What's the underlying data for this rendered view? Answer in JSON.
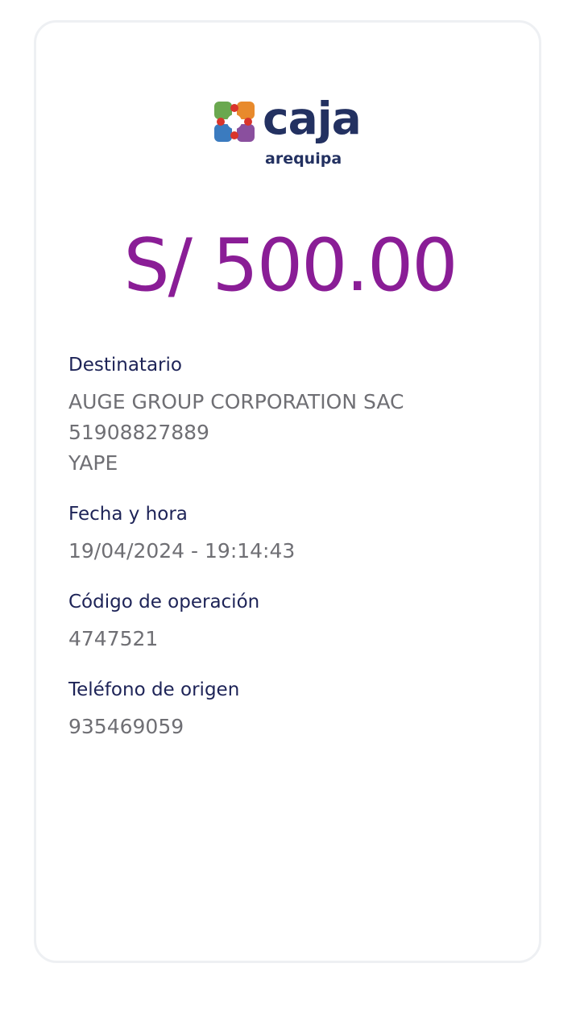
{
  "brand": {
    "name": "caja",
    "subname": "arequipa",
    "colors": {
      "navy": "#233161",
      "purple": "#8a1d96",
      "green": "#6aa84f",
      "red": "#d9342b",
      "blue": "#3b7bbf",
      "orange": "#e88a2c"
    }
  },
  "receipt": {
    "amount": "S/ 500.00",
    "recipient": {
      "label": "Destinatario",
      "name": "AUGE GROUP CORPORATION SAC",
      "phone": "51908827889",
      "wallet": "YAPE"
    },
    "datetime": {
      "label": "Fecha y hora",
      "value": "19/04/2024 - 19:14:43"
    },
    "operation_code": {
      "label": "Código de operación",
      "value": "4747521"
    },
    "origin_phone": {
      "label": "Teléfono de origen",
      "value": "935469059"
    }
  }
}
